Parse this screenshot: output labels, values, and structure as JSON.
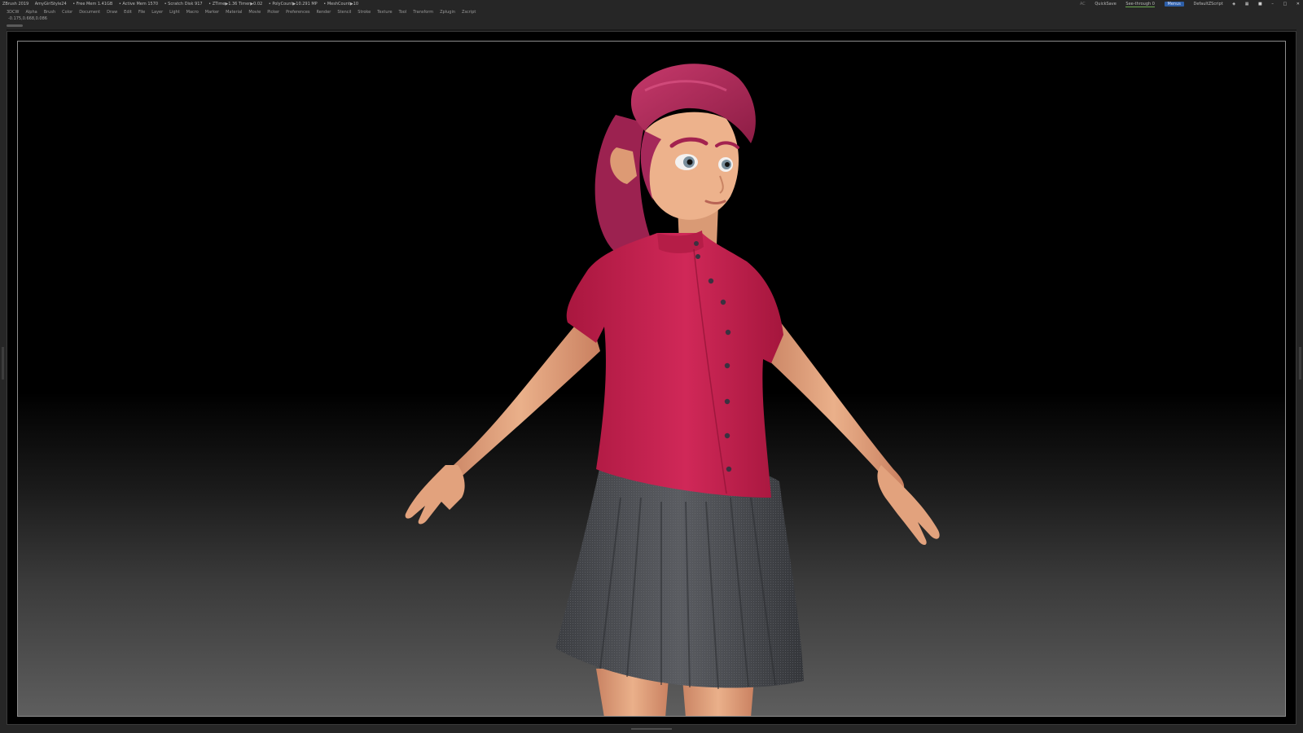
{
  "titlebar": {
    "app": "ZBrush 2019",
    "document": "AmyGirlStyle24",
    "free_mem": "• Free Mem 1.41GB",
    "active_mem": "• Active Mem 1570",
    "scratch_disk": "• Scratch Disk 917",
    "ztime": "• ZTime▶1.36 Timer▶0.02",
    "polycount": "• PolyCount▶10.291 MP",
    "meshcount": "• MeshCount▶10",
    "ac": "AC",
    "quicksave": "QuickSave",
    "see_through": "See-through  0",
    "menus": "Menus",
    "script": "DefaultZScript"
  },
  "menubar": {
    "items": [
      "3DCW",
      "Alpha",
      "Brush",
      "Color",
      "Document",
      "Draw",
      "Edit",
      "File",
      "Layer",
      "Light",
      "Macro",
      "Marker",
      "Material",
      "Movie",
      "Picker",
      "Preferences",
      "Render",
      "Stencil",
      "Stroke",
      "Texture",
      "Tool",
      "Transform",
      "Zplugin",
      "Zscript"
    ]
  },
  "coords": "-0.175,0.668,0.086",
  "colors": {
    "shirt": "#c41f4e",
    "hair": "#b8305f",
    "skin": "#e8a680",
    "skirt": "#4a4c50",
    "ui_bg": "#262626",
    "accent": "#2e5fa8"
  },
  "icons": {
    "viewport_model": "3d-character-model"
  }
}
